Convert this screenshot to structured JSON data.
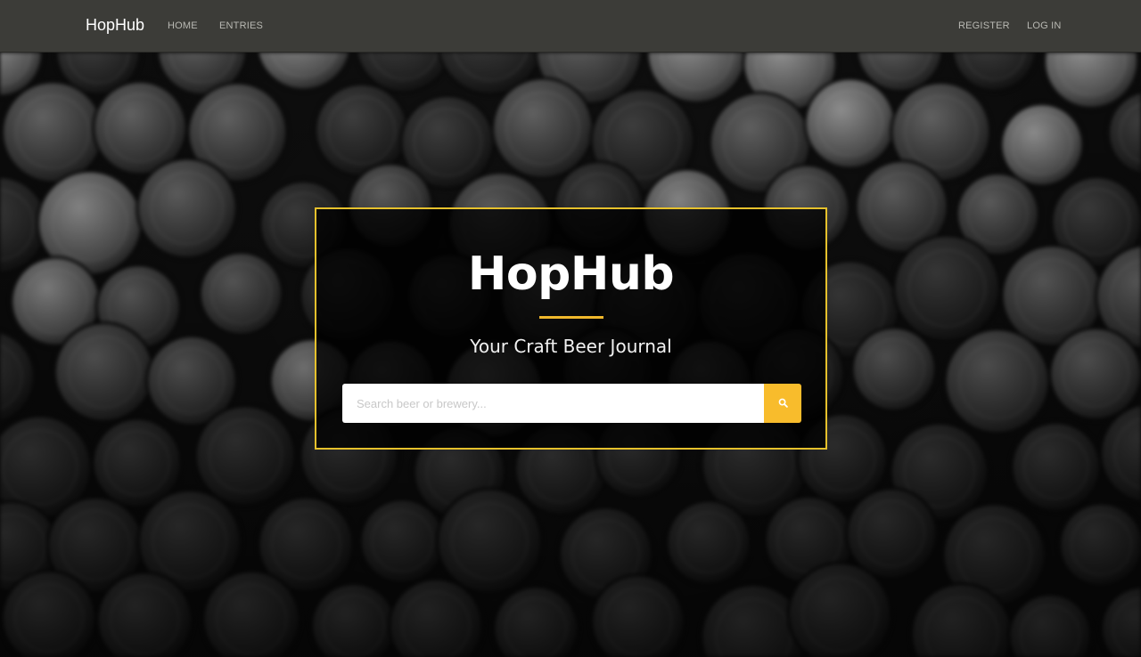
{
  "navbar": {
    "brand": "HopHub",
    "links": [
      "HOME",
      "ENTRIES"
    ],
    "auth_links": [
      "REGISTER",
      "LOG IN"
    ]
  },
  "hero": {
    "title": "HopHub",
    "subtitle": "Your Craft Beer Journal",
    "search": {
      "placeholder": "Search beer or brewery...",
      "value": "",
      "button_icon": "search-icon"
    },
    "background": "bottle-caps-photo"
  },
  "colors": {
    "navbar_bg": "#3c3c38",
    "accent": "#f8bc2c",
    "panel_border": "#e6c12c"
  }
}
